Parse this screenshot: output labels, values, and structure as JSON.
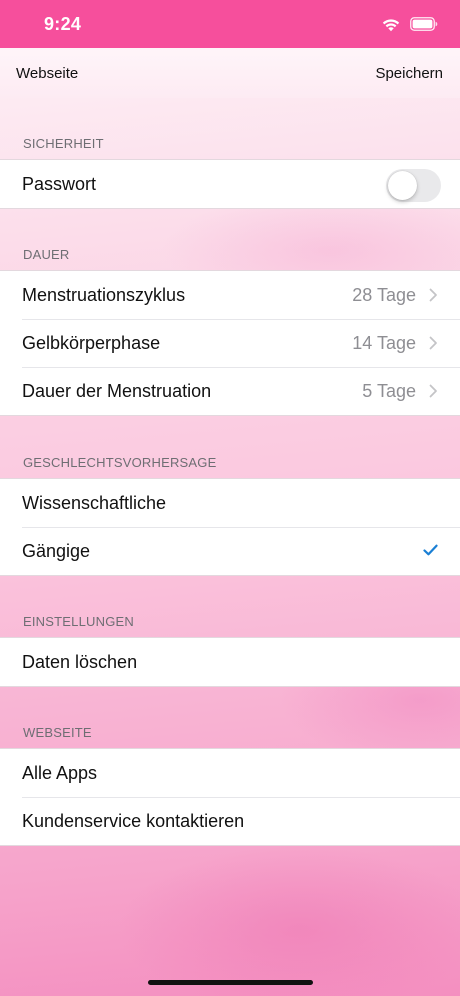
{
  "status_bar": {
    "time": "9:24",
    "icons": [
      "wifi-icon",
      "battery-icon"
    ],
    "background_color": "#f64f9c"
  },
  "nav": {
    "left_label": "Webseite",
    "right_label": "Speichern"
  },
  "sections": {
    "security": {
      "header": "SICHERHEIT",
      "password": {
        "label": "Passwort",
        "toggle_on": false
      }
    },
    "duration": {
      "header": "DAUER",
      "rows": [
        {
          "label": "Menstruationszyklus",
          "value": "28 Tage"
        },
        {
          "label": "Gelbkörperphase",
          "value": "14 Tage"
        },
        {
          "label": "Dauer der Menstruation",
          "value": "5 Tage"
        }
      ]
    },
    "gender_prediction": {
      "header": "GESCHLECHTSVORHERSAGE",
      "rows": [
        {
          "label": "Wissenschaftliche",
          "selected": false
        },
        {
          "label": "Gängige",
          "selected": true
        }
      ]
    },
    "settings": {
      "header": "EINSTELLUNGEN",
      "rows": [
        {
          "label": "Daten löschen"
        }
      ]
    },
    "website": {
      "header": "WEBSEITE",
      "rows": [
        {
          "label": "Alle Apps"
        },
        {
          "label": "Kundenservice kontaktieren"
        }
      ]
    }
  },
  "colors": {
    "accent": "#f64f9c",
    "checkmark": "#1a7fd4",
    "secondary_text": "#8e8e93"
  }
}
